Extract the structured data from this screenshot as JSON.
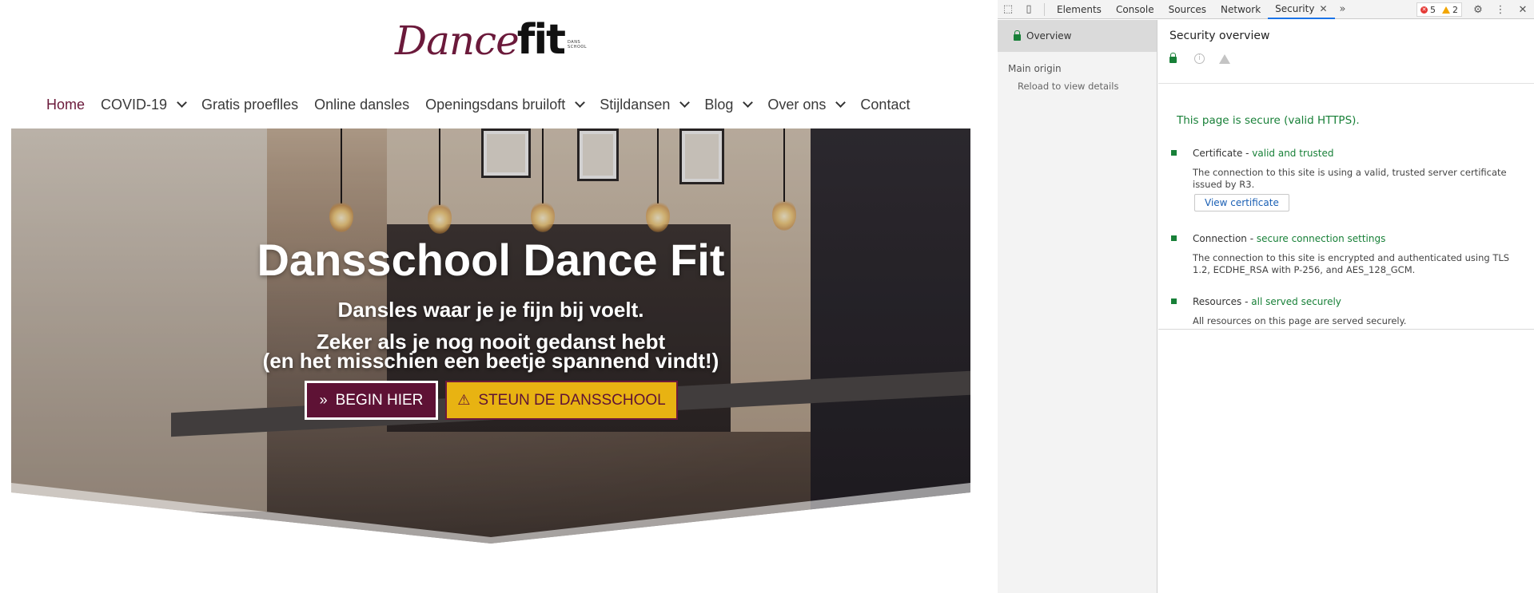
{
  "site": {
    "logo": {
      "script": "Dance",
      "bold": "fit",
      "tagline": "DANS SCHOOL"
    },
    "nav": [
      {
        "label": "Home",
        "active": true,
        "dropdown": false
      },
      {
        "label": "COVID-19",
        "active": false,
        "dropdown": true
      },
      {
        "label": "Gratis proeflles",
        "active": false,
        "dropdown": false
      },
      {
        "label": "Online dansles",
        "active": false,
        "dropdown": false
      },
      {
        "label": "Openingsdans bruiloft",
        "active": false,
        "dropdown": true
      },
      {
        "label": "Stijldansen",
        "active": false,
        "dropdown": true
      },
      {
        "label": "Blog",
        "active": false,
        "dropdown": true
      },
      {
        "label": "Over ons",
        "active": false,
        "dropdown": true
      },
      {
        "label": "Contact",
        "active": false,
        "dropdown": false
      }
    ],
    "hero": {
      "title": "Dansschool Dance Fit",
      "subtitle1": "Dansles waar je je fijn bij voelt.",
      "subtitle2": "Zeker als je nog nooit gedanst hebt",
      "subtitle3": "(en het misschien een beetje spannend vindt!)",
      "begin_button": "BEGIN HIER",
      "begin_icon": "»",
      "steun_button": "STEUN DE DANSSCHOOL",
      "steun_icon": "⚠"
    }
  },
  "devtools": {
    "tabs": [
      {
        "label": "Elements",
        "active": false
      },
      {
        "label": "Console",
        "active": false
      },
      {
        "label": "Sources",
        "active": false
      },
      {
        "label": "Network",
        "active": false
      },
      {
        "label": "Security",
        "active": true
      }
    ],
    "more_tabs": "»",
    "error_count": "5",
    "warning_count": "2",
    "sidebar": {
      "overview": "Overview",
      "main_origin": "Main origin",
      "reload": "Reload to view details"
    },
    "overview": {
      "title": "Security overview",
      "secure_message": "This page is secure (valid HTTPS).",
      "certificate": {
        "label": "Certificate - ",
        "status": "valid and trusted",
        "description": "The connection to this site is using a valid, trusted server certificate issued by R3.",
        "button": "View certificate"
      },
      "connection": {
        "label": "Connection - ",
        "status": "secure connection settings",
        "description": "The connection to this site is encrypted and authenticated using TLS 1.2, ECDHE_RSA with P-256, and AES_128_GCM."
      },
      "resources": {
        "label": "Resources - ",
        "status": "all served securely",
        "description": "All resources on this page are served securely."
      }
    },
    "colors": {
      "secure_green": "#188038",
      "accent_blue": "#1a73e8",
      "brand": "#6b1a3b",
      "steun_yellow": "#e8b312"
    }
  }
}
